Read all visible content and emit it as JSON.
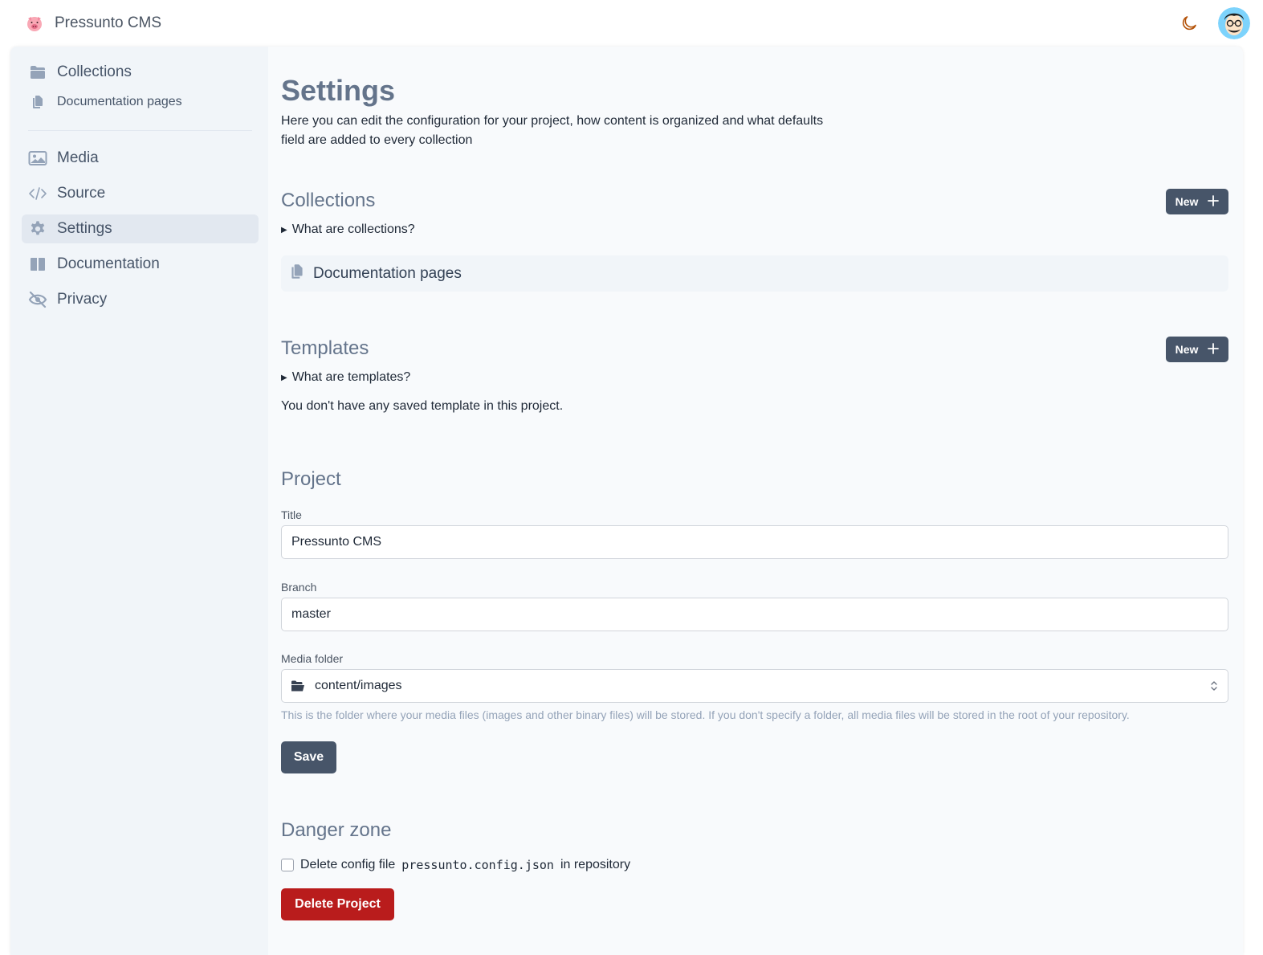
{
  "app": {
    "name": "Pressunto CMS"
  },
  "sidebar": {
    "top": [
      {
        "label": "Collections",
        "icon": "folder-icon"
      },
      {
        "label": "Documentation pages",
        "icon": "files-icon"
      }
    ],
    "items": [
      {
        "label": "Media",
        "icon": "image-icon"
      },
      {
        "label": "Source",
        "icon": "code-icon"
      },
      {
        "label": "Settings",
        "icon": "gear-icon",
        "active": true
      },
      {
        "label": "Documentation",
        "icon": "book-icon"
      },
      {
        "label": "Privacy",
        "icon": "eye-slash-icon"
      }
    ]
  },
  "page": {
    "title": "Settings",
    "description": "Here you can edit the configuration for your project, how content is organized and what defaults field are added to every collection"
  },
  "collections": {
    "title": "Collections",
    "new_label": "New",
    "summary": "What are collections?",
    "items": [
      "Documentation pages"
    ]
  },
  "templates": {
    "title": "Templates",
    "new_label": "New",
    "summary": "What are templates?",
    "empty": "You don't have any saved template in this project."
  },
  "project": {
    "title": "Project",
    "title_label": "Title",
    "title_value": "Pressunto CMS",
    "branch_label": "Branch",
    "branch_value": "master",
    "media_label": "Media folder",
    "media_value": "content/images",
    "media_help": "This is the folder where your media files (images and other binary files) will be stored. If you don't specify a folder, all media files will be stored in the root of your repository.",
    "save_label": "Save"
  },
  "danger": {
    "title": "Danger zone",
    "check_prefix": "Delete config file",
    "check_file": "pressunto.config.json",
    "check_suffix": "in repository",
    "delete_label": "Delete Project"
  },
  "colors": {
    "accent": "#475569",
    "danger": "#b91c1c",
    "moon": "#b45309"
  }
}
